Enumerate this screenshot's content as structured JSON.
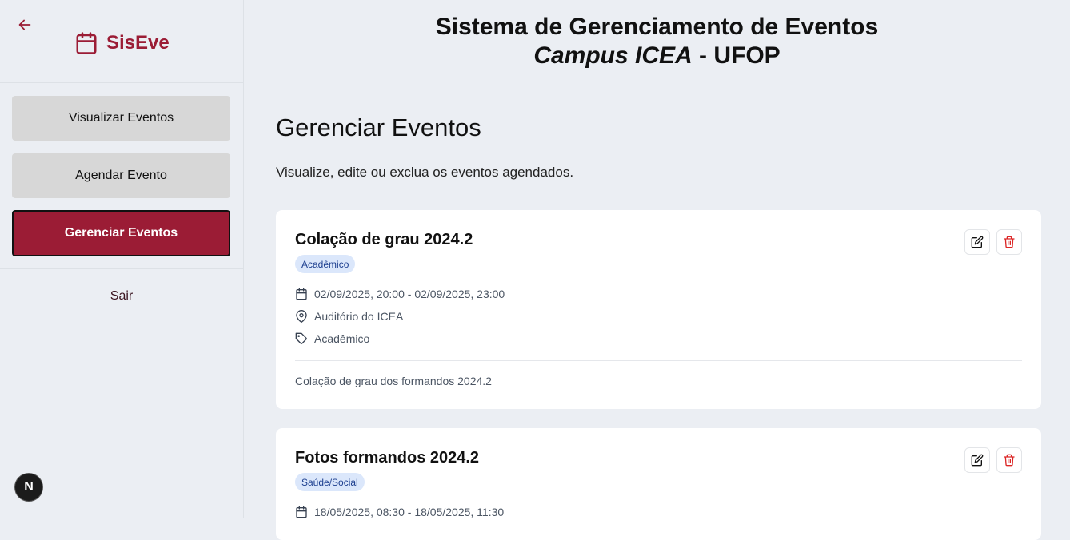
{
  "sidebar": {
    "brand": "SisEve",
    "nav": [
      {
        "label": "Visualizar Eventos",
        "active": false
      },
      {
        "label": "Agendar Evento",
        "active": false
      },
      {
        "label": "Gerenciar Eventos",
        "active": true
      }
    ],
    "logout": "Sair",
    "dev_badge": "N"
  },
  "header": {
    "line1": "Sistema de Gerenciamento de Eventos",
    "line2_italic": "Campus ICEA",
    "line2_rest": " - UFOP"
  },
  "page": {
    "title": "Gerenciar Eventos",
    "subtitle": "Visualize, edite ou exclua os eventos agendados."
  },
  "events": [
    {
      "title": "Colação de grau 2024.2",
      "tag": "Acadêmico",
      "datetime": "02/09/2025, 20:00 - 02/09/2025, 23:00",
      "location": "Auditório do ICEA",
      "category": "Acadêmico",
      "description": "Colação de grau dos formandos 2024.2"
    },
    {
      "title": "Fotos formandos 2024.2",
      "tag": "Saúde/Social",
      "datetime": "18/05/2025, 08:30 - 18/05/2025, 11:30"
    }
  ],
  "colors": {
    "brand": "#9b1c35",
    "chip_bg": "#dbe7fb",
    "chip_text": "#1d3f8f",
    "delete": "#dc2626"
  }
}
